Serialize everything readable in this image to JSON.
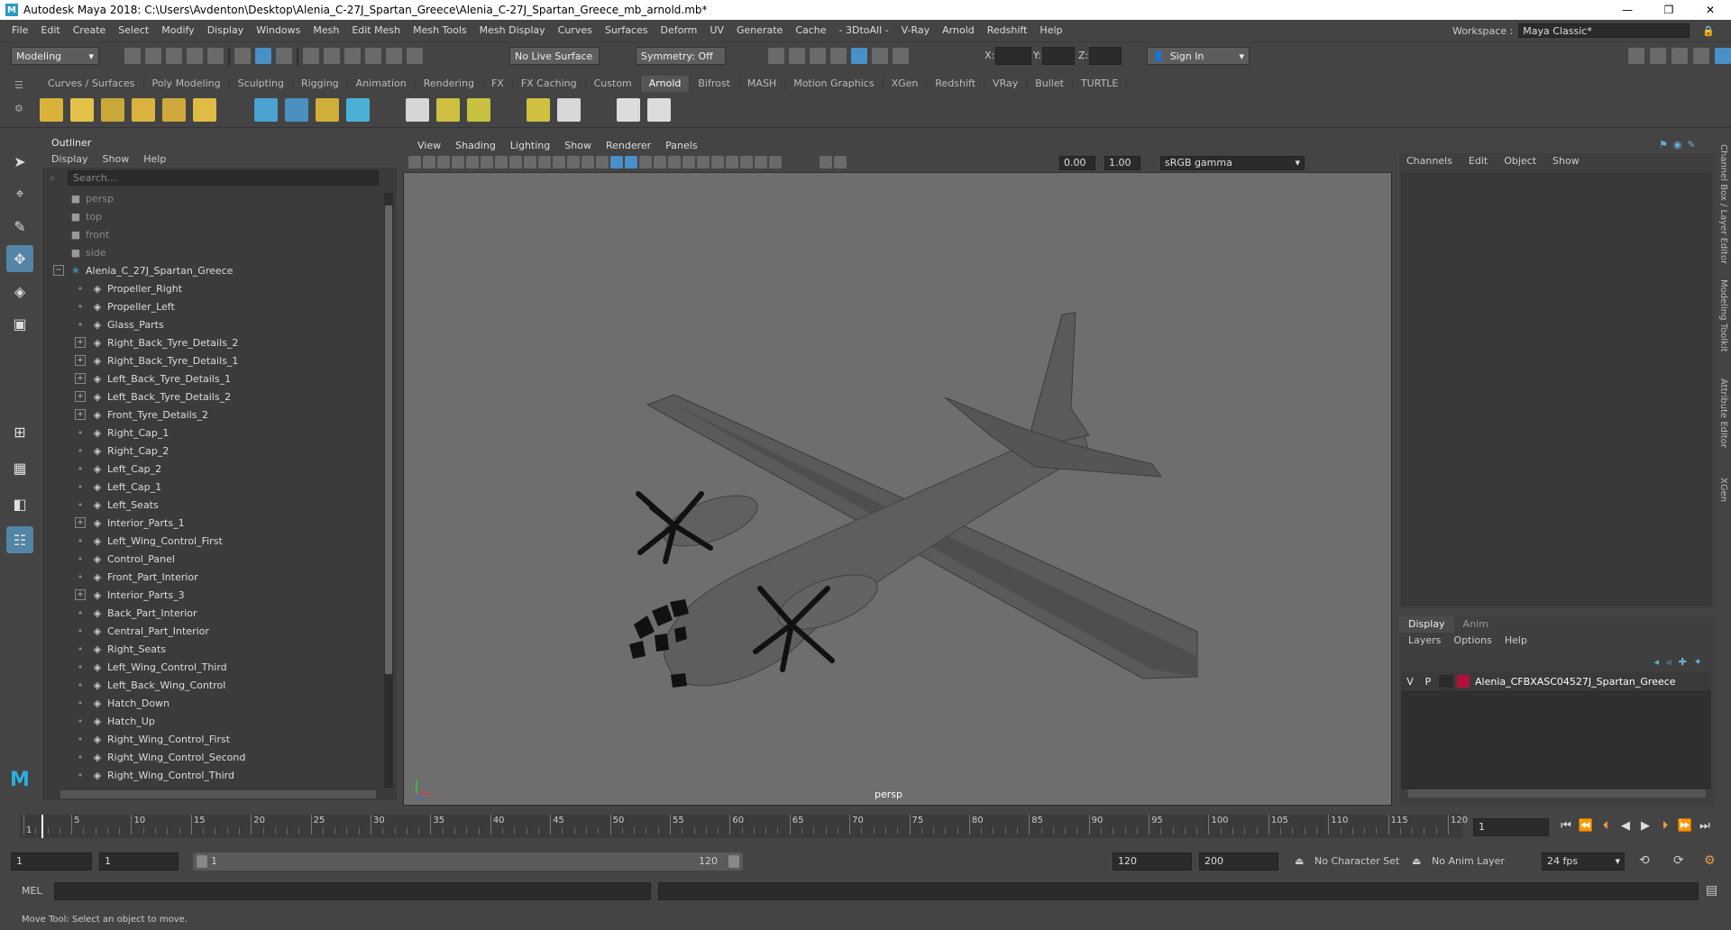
{
  "window": {
    "title": "Autodesk Maya 2018: C:\\Users\\Avdenton\\Desktop\\Alenia_C-27J_Spartan_Greece\\Alenia_C-27J_Spartan_Greece_mb_arnold.mb*",
    "app_icon": "M",
    "minimize": "—",
    "maximize": "❐",
    "close": "✕"
  },
  "menubar": {
    "items": [
      "File",
      "Edit",
      "Create",
      "Select",
      "Modify",
      "Display",
      "Windows",
      "Mesh",
      "Edit Mesh",
      "Mesh Tools",
      "Mesh Display",
      "Curves",
      "Surfaces",
      "Deform",
      "UV",
      "Generate",
      "Cache",
      "- 3DtoAll -",
      "V-Ray",
      "Arnold",
      "Redshift",
      "Help"
    ],
    "workspace_label": "Workspace :",
    "workspace_value": "Maya Classic*"
  },
  "statusline": {
    "mode": "Modeling",
    "live_surface": "No Live Surface",
    "symmetry": "Symmetry: Off",
    "x_label": "X:",
    "y_label": "Y:",
    "z_label": "Z:",
    "sign_in": "Sign In"
  },
  "shelf": {
    "tabs": [
      "Curves / Surfaces",
      "Poly Modeling",
      "Sculpting",
      "Rigging",
      "Animation",
      "Rendering",
      "FX",
      "FX Caching",
      "Custom",
      "Arnold",
      "Bifrost",
      "MASH",
      "Motion Graphics",
      "XGen",
      "Redshift",
      "VRay",
      "Bullet",
      "TURTLE"
    ],
    "active_tab": "Arnold"
  },
  "outliner": {
    "title": "Outliner",
    "menu": [
      "Display",
      "Show",
      "Help"
    ],
    "search_placeholder": "Search...",
    "cameras": [
      "persp",
      "top",
      "front",
      "side"
    ],
    "root": "Alenia_C_27J_Spartan_Greece",
    "items": [
      {
        "label": "Propeller_Right",
        "expandable": false
      },
      {
        "label": "Propeller_Left",
        "expandable": false
      },
      {
        "label": "Glass_Parts",
        "expandable": false
      },
      {
        "label": "Right_Back_Tyre_Details_2",
        "expandable": true
      },
      {
        "label": "Right_Back_Tyre_Details_1",
        "expandable": true
      },
      {
        "label": "Left_Back_Tyre_Details_1",
        "expandable": true
      },
      {
        "label": "Left_Back_Tyre_Details_2",
        "expandable": true
      },
      {
        "label": "Front_Tyre_Details_2",
        "expandable": true
      },
      {
        "label": "Right_Cap_1",
        "expandable": false
      },
      {
        "label": "Right_Cap_2",
        "expandable": false
      },
      {
        "label": "Left_Cap_2",
        "expandable": false
      },
      {
        "label": "Left_Cap_1",
        "expandable": false
      },
      {
        "label": "Left_Seats",
        "expandable": false
      },
      {
        "label": "Interior_Parts_1",
        "expandable": true
      },
      {
        "label": "Left_Wing_Control_First",
        "expandable": false
      },
      {
        "label": "Control_Panel",
        "expandable": false
      },
      {
        "label": "Front_Part_Interior",
        "expandable": false
      },
      {
        "label": "Interior_Parts_3",
        "expandable": true
      },
      {
        "label": "Back_Part_Interior",
        "expandable": false
      },
      {
        "label": "Central_Part_Interior",
        "expandable": false
      },
      {
        "label": "Right_Seats",
        "expandable": false
      },
      {
        "label": "Left_Wing_Control_Third",
        "expandable": false
      },
      {
        "label": "Left_Back_Wing_Control",
        "expandable": false
      },
      {
        "label": "Hatch_Down",
        "expandable": false
      },
      {
        "label": "Hatch_Up",
        "expandable": false
      },
      {
        "label": "Right_Wing_Control_First",
        "expandable": false
      },
      {
        "label": "Right_Wing_Control_Second",
        "expandable": false
      },
      {
        "label": "Right_Wing_Control_Third",
        "expandable": false
      }
    ]
  },
  "viewport": {
    "menu": [
      "View",
      "Shading",
      "Lighting",
      "Show",
      "Renderer",
      "Panels"
    ],
    "exposure": "0.00",
    "gamma": "1.00",
    "color_space": "sRGB gamma",
    "camera_label": "persp"
  },
  "channelbox": {
    "menu": [
      "Channels",
      "Edit",
      "Object",
      "Show"
    ]
  },
  "layer_editor": {
    "tabs": [
      "Display",
      "Anim"
    ],
    "active_tab": "Display",
    "menu": [
      "Layers",
      "Options",
      "Help"
    ],
    "layer": {
      "v": "V",
      "p": "P",
      "name": "Alenia_CFBXASC04527J_Spartan_Greece"
    }
  },
  "side_tabs": [
    "Channel Box / Layer Editor",
    "Modeling Toolkit",
    "Attribute Editor",
    "XGen"
  ],
  "timeline": {
    "ticks": [
      "1",
      "5",
      "10",
      "15",
      "20",
      "25",
      "30",
      "35",
      "40",
      "45",
      "50",
      "55",
      "60",
      "65",
      "70",
      "75",
      "80",
      "85",
      "90",
      "95",
      "100",
      "105",
      "110",
      "115",
      "120"
    ],
    "current_frame": "1"
  },
  "range": {
    "start": "1",
    "playback_start": "1",
    "range_start": "1",
    "range_end": "120",
    "playback_end": "120",
    "end": "200",
    "character_set": "No Character Set",
    "anim_layer": "No Anim Layer",
    "fps": "24 fps"
  },
  "cmdline": {
    "label": "MEL"
  },
  "helpline": {
    "text": "Move Tool: Select an object to move."
  },
  "colors": {
    "accent": "#5285a6",
    "layer_color": "#b0103a",
    "viewport_bg": "#6e6e6e"
  }
}
